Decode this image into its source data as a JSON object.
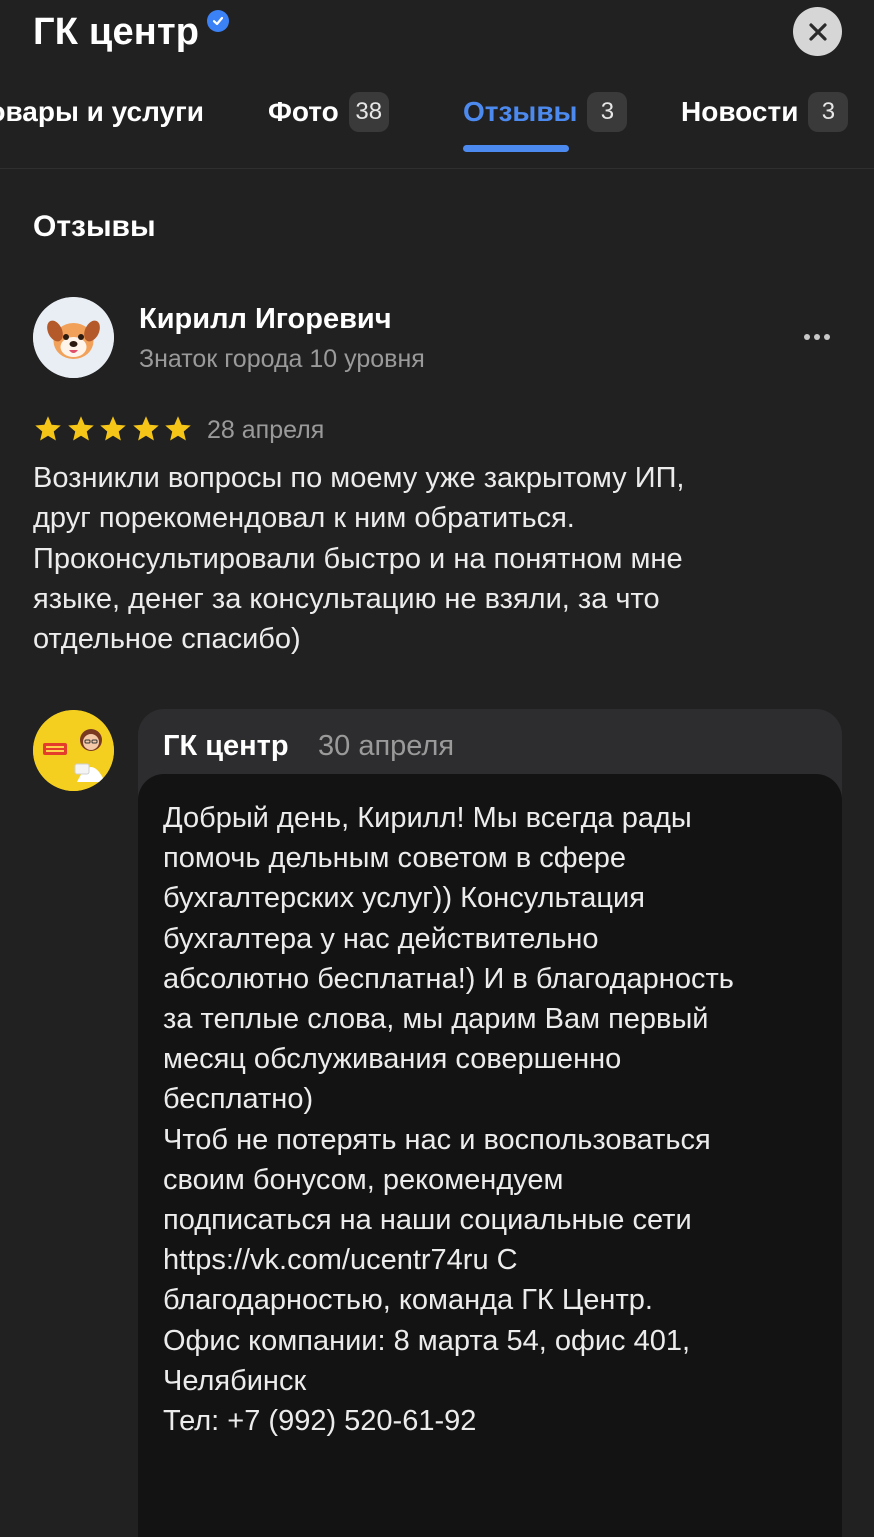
{
  "header": {
    "title": "ГК центр",
    "verified_icon": "verified-check-icon",
    "close_icon": "close-icon"
  },
  "tabs": [
    {
      "label": "Товары и услуги",
      "badge": ""
    },
    {
      "label": "Фото",
      "badge": "38"
    },
    {
      "label": "Отзывы",
      "badge": "3",
      "active": true
    },
    {
      "label": "Новости",
      "badge": "3"
    }
  ],
  "section": {
    "title": "Отзывы"
  },
  "review": {
    "author": "Кирилл Игоревич",
    "level": "Знаток города 10 уровня",
    "rating": 5,
    "date": "28 апреля",
    "text": "Возникли вопросы по моему уже закрытому ИП,\nдруг порекомендовал к ним обратиться.\nПроконсультировали быстро и на понятном мне\nязыке, денег за консультацию не взяли, за что\nотдельное спасибо)",
    "avatar_icon": "puppy-avatar-icon",
    "more_icon": "more-dots-icon"
  },
  "reply": {
    "company": "ГК центр",
    "date": "30 апреля",
    "text": "Добрый день, Кирилл! Мы всегда рады\nпомочь дельным советом в сфере\nбухгалтерских услуг)) Консультация\nбухгалтера у нас действительно\nабсолютно бесплатна!) И в благодарность\nза теплые слова, мы дарим Вам первый\nмесяц обслуживания совершенно\nбесплатно)\nЧтоб не потерять нас и воспользоваться\nсвоим бонусом, рекомендуем\nподписаться на наши социальные сети\nhttps://vk.com/ucentr74ru С\nблагодарностью, команда ГК Центр.\nОфис компании: 8 марта 54, офис 401,\nЧелябинск\nТел: +7 (992) 520-61-92",
    "avatar_icon": "company-logo-avatar-icon"
  },
  "colors": {
    "background": "#212121",
    "accent": "#4d8af0",
    "star": "#f5c518",
    "muted_text": "#9a9a9a"
  }
}
